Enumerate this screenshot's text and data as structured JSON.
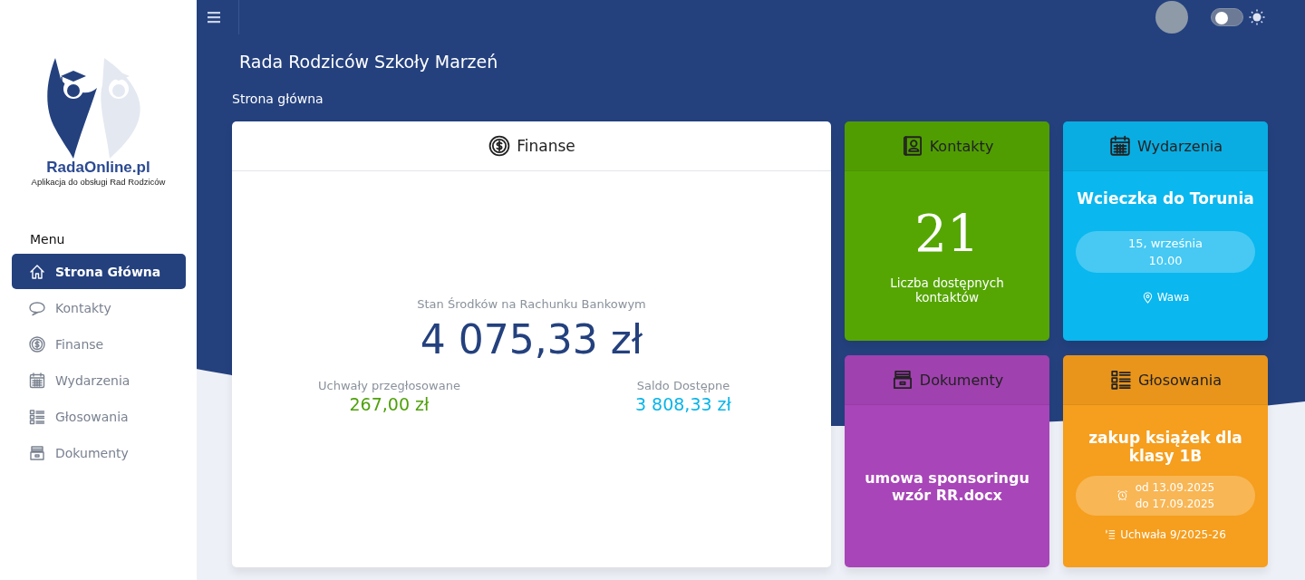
{
  "sidebar": {
    "logo": {
      "name": "RadaOnline.pl",
      "tagline": "Aplikacja do obsługi Rad Rodziców"
    },
    "menu_title": "Menu",
    "items": [
      {
        "label": "Strona Główna",
        "kind": "home",
        "selected": true
      },
      {
        "label": "Kontakty",
        "kind": "contacts",
        "selected": false
      },
      {
        "label": "Finanse",
        "kind": "finance",
        "selected": false
      },
      {
        "label": "Wydarzenia",
        "kind": "events",
        "selected": false
      },
      {
        "label": "Głosowania",
        "kind": "votes",
        "selected": false
      },
      {
        "label": "Dokumenty",
        "kind": "documents",
        "selected": false
      }
    ]
  },
  "topbar": {
    "theme_toggle": {
      "on": false
    }
  },
  "page": {
    "title": "Rada Rodziców Szkoły Marzeń",
    "breadcrumb": "Strona główna"
  },
  "finance": {
    "title": "Finanse",
    "balance_label": "Stan Środków na Rachunku Bankowym",
    "balance": "4 075,33 zł",
    "stats": [
      {
        "label": "Uchwały przegłosowane",
        "value": "267,00 zł",
        "color": "#4fa00b"
      },
      {
        "label": "Saldo Dostępne",
        "value": "3 808,33 zł",
        "color": "#0ab4e8"
      }
    ]
  },
  "tiles": [
    {
      "kind": "contacts",
      "title": "Kontakty",
      "color": "#55a603",
      "count": "21",
      "caption": "Liczba dostępnych kontaktów"
    },
    {
      "kind": "event",
      "title": "Wydarzenia",
      "color": "#0ab7ef",
      "name": "Wcieczka do Torunia",
      "date": "15, września",
      "time": "10.00",
      "place": "Wawa"
    },
    {
      "kind": "document",
      "title": "Dokumenty",
      "color": "#a845b8",
      "name": "umowa sponsoringu wzór RR.docx"
    },
    {
      "kind": "vote",
      "title": "Głosowania",
      "color": "#f69e1d",
      "name": "zakup książek dla klasy 1B",
      "from": "od 13.09.2025",
      "to": "do 17.09.2025",
      "resolution": "Uchwała 9/2025-26"
    }
  ]
}
